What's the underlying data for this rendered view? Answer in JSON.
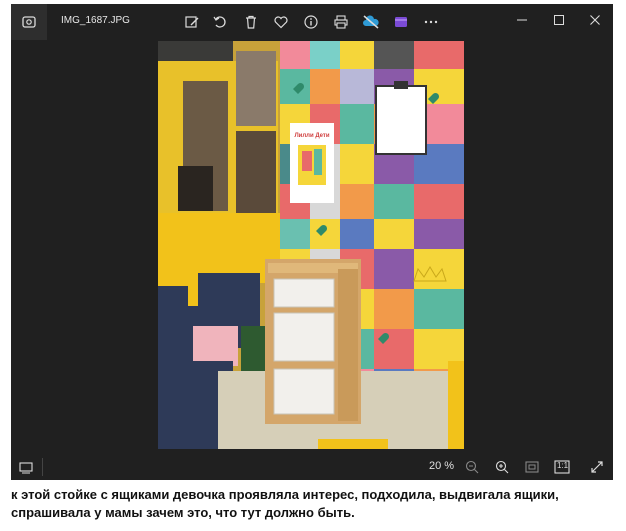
{
  "window": {
    "filename": "IMG_1687.JPG",
    "icons": {
      "app": "photos-app-icon",
      "edit": "edit-image-icon",
      "rotate": "rotate-icon",
      "delete": "trash-icon",
      "favorite": "heart-icon",
      "info": "info-icon",
      "print": "print-icon",
      "onedrive": "cloud-off-icon",
      "video_editor": "video-editor-icon",
      "more": "more-icon",
      "minimize": "minimize-icon",
      "maximize": "maximize-icon",
      "close": "close-icon"
    }
  },
  "photo": {
    "poster_title": "Лилли Дети"
  },
  "statusbar": {
    "zoom": "20 %",
    "actual_size_label": "1:1"
  },
  "caption": "к этой стойке с ящиками девочка проявляла интерес, подходила, выдвигала ящики, спрашивала у мамы зачем это, что тут должно быть."
}
